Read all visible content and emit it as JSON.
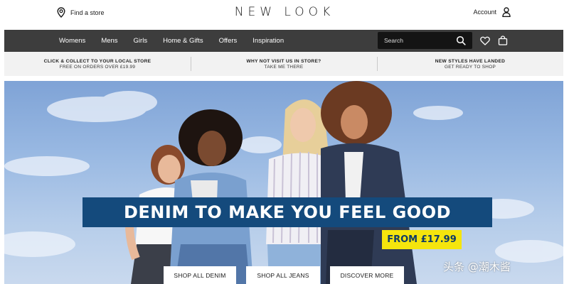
{
  "header": {
    "find_store": "Find a store",
    "logo": "NEW LOOK",
    "account": "Account"
  },
  "nav": {
    "items": [
      "Womens",
      "Mens",
      "Girls",
      "Home & Gifts",
      "Offers",
      "Inspiration"
    ],
    "search_placeholder": "Search",
    "background": "#3d3d3d"
  },
  "promos": [
    {
      "title": "CLICK & COLLECT TO YOUR LOCAL STORE",
      "sub": "FREE ON ORDERS OVER £19.99"
    },
    {
      "title": "WHY NOT VISIT US IN STORE?",
      "sub": "TAKE ME THERE"
    },
    {
      "title": "NEW STYLES HAVE LANDED",
      "sub": "GET READY TO SHOP"
    }
  ],
  "hero": {
    "headline": "DENIM TO MAKE YOU FEEL GOOD",
    "price": "FROM £17.99",
    "buttons": [
      "SHOP ALL DENIM",
      "SHOP ALL JEANS",
      "DISCOVER MORE"
    ],
    "headline_color": "#144a7c",
    "price_badge_color": "#f5e50d"
  },
  "watermark": "头条 @潮木酱"
}
